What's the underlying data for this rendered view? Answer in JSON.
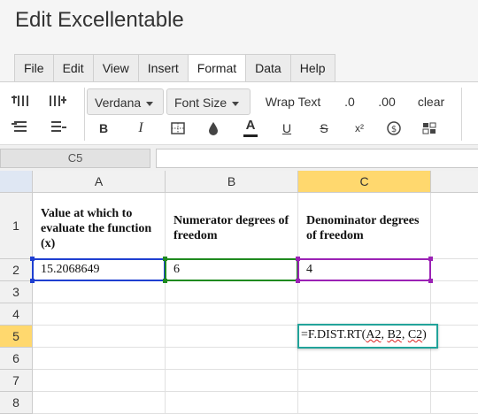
{
  "app": {
    "title": "Edit Excellentable"
  },
  "menu": {
    "tabs": [
      "File",
      "Edit",
      "View",
      "Insert",
      "Format",
      "Data",
      "Help"
    ],
    "active": "Format"
  },
  "toolbar": {
    "font_family": "Verdana",
    "font_size": "Font Size",
    "wrap_text": "Wrap Text",
    "decimal_less": ".0",
    "decimal_more": ".00",
    "clear": "clear",
    "bold": "B",
    "italic": "I",
    "text_color": "A",
    "underline": "U",
    "strike": "S",
    "superscript": "x²"
  },
  "formula_bar": {
    "cell_ref": "C5",
    "content": ""
  },
  "sheet": {
    "columns": [
      "A",
      "B",
      "C"
    ],
    "selected_column": "C",
    "rows": [
      "1",
      "2",
      "3",
      "4",
      "5",
      "6",
      "7",
      "8"
    ],
    "selected_row": "5",
    "cells": {
      "A1": "Value at which to evaluate the function (x)",
      "B1": "Numerator degrees of freedom",
      "C1": "Denominator degrees of freedom",
      "A2": "15.2068649",
      "B2": "6",
      "C2": "4"
    },
    "editor": {
      "cell": "C5",
      "prefix": "=F.DIST.RT(",
      "arg1": "A2",
      "sep1": ", ",
      "arg2": "B2",
      "sep2": ", ",
      "arg3": "C2",
      "suffix": ")"
    },
    "ref_colors": {
      "A2": "#1f3fd1",
      "B2": "#1f8a1f",
      "C2": "#9b22b5",
      "editor": "#22a39a"
    }
  }
}
